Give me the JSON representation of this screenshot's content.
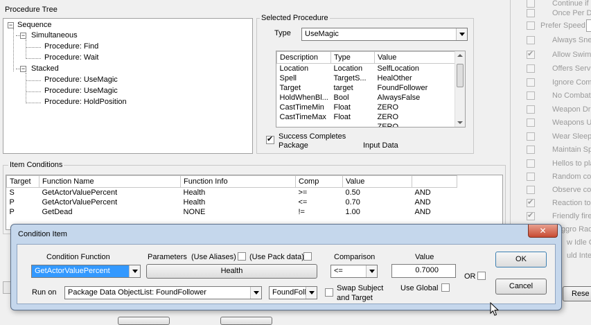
{
  "procedure_tree": {
    "label": "Procedure Tree",
    "nodes": {
      "sequence": "Sequence",
      "simultaneous": "Simultaneous",
      "find": "Procedure: Find",
      "wait": "Procedure: Wait",
      "stacked": "Stacked",
      "usemagic1": "Procedure: UseMagic",
      "usemagic2": "Procedure: UseMagic",
      "holdposition": "Procedure: HoldPosition"
    }
  },
  "selected_procedure": {
    "label": "Selected Procedure",
    "type_label": "Type",
    "type_value": "UseMagic",
    "columns": [
      "Description",
      "Type",
      "Value"
    ],
    "rows": [
      [
        "Location",
        "Location",
        "SelfLocation"
      ],
      [
        "Spell",
        "TargetS...",
        "HealOther"
      ],
      [
        "Target",
        "target",
        "FoundFollower"
      ],
      [
        "HoldWhenBl...",
        "Bool",
        "AlwaysFalse"
      ],
      [
        "CastTimeMin",
        "Float",
        "ZERO"
      ],
      [
        "CastTimeMax",
        "Float",
        "ZERO"
      ],
      [
        "...",
        "...",
        "ZERO"
      ]
    ],
    "success_checkbox_label_1": "Success Completes",
    "success_checkbox_label_2": "Package",
    "input_data_label": "Input Data"
  },
  "item_conditions": {
    "label": "Item Conditions",
    "columns": [
      "Target",
      "Function Name",
      "Function Info",
      "Comp",
      "Value",
      ""
    ],
    "rows": [
      [
        "S",
        "GetActorValuePercent",
        "Health",
        ">=",
        "0.50",
        "AND"
      ],
      [
        "P",
        "GetActorValuePercent",
        "Health",
        "<=",
        "0.70",
        "AND"
      ],
      [
        "P",
        "GetDead",
        "NONE",
        "!=",
        "1.00",
        "AND"
      ]
    ]
  },
  "right_options": {
    "items": [
      {
        "label": "Continue if",
        "checked": false
      },
      {
        "label": "Once Per D",
        "checked": false
      },
      {
        "label": "Prefer Speed",
        "checked": false
      },
      {
        "label": "Always Sne",
        "checked": false
      },
      {
        "label": "Allow Swim",
        "checked": true
      },
      {
        "label": "Offers Servi",
        "checked": false
      },
      {
        "label": "Ignore Comb",
        "checked": false
      },
      {
        "label": "No Combat",
        "checked": false
      },
      {
        "label": "Weapon Dr",
        "checked": false
      },
      {
        "label": "Weapons U",
        "checked": false
      },
      {
        "label": "Wear Sleep",
        "checked": false
      },
      {
        "label": "Maintain Sp",
        "checked": false
      },
      {
        "label": "Hellos to pla",
        "checked": false
      },
      {
        "label": "Random co",
        "checked": false
      },
      {
        "label": "Observe co",
        "checked": false
      },
      {
        "label": "Reaction to",
        "checked": true
      },
      {
        "label": "Friendly fire",
        "checked": true
      },
      {
        "label": "ggro Radiu",
        "checked": false
      },
      {
        "label": "w Idle C",
        "checked": false
      },
      {
        "label": "uld Intera",
        "checked": false
      }
    ],
    "reset_label": "Rese"
  },
  "dialog": {
    "title": "Condition Item",
    "close_label": "✕",
    "condition_function_label": "Condition Function",
    "condition_function_value": "GetActorValuePercent",
    "parameters_label": "Parameters",
    "use_aliases_label": "(Use Aliases)",
    "use_pack_data_label": "(Use Pack data)",
    "parameter_button": "Health",
    "comparison_label": "Comparison",
    "comparison_value": "<=",
    "value_label": "Value",
    "value_value": "0.7000",
    "or_label": "OR",
    "ok_label": "OK",
    "cancel_label": "Cancel",
    "run_on_label": "Run on",
    "run_on_value": "Package Data ObjectList: FoundFollower",
    "run_on_secondary": "FoundFollo",
    "swap_label_1": "Swap Subject",
    "swap_label_2": "and Target",
    "use_global_label": "Use Global"
  }
}
